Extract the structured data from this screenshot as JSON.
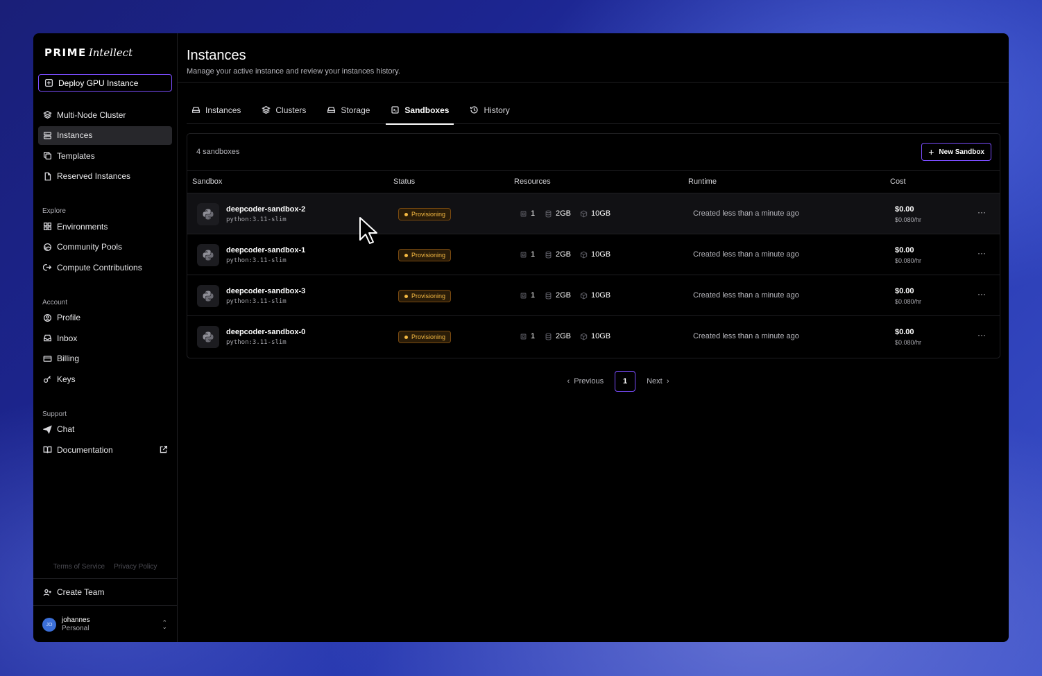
{
  "brand": {
    "name_main": "PRIME",
    "name_italic": "Intellect"
  },
  "sidebar": {
    "deploy_label": "Deploy GPU Instance",
    "primary": [
      {
        "label": "Multi-Node Cluster",
        "icon": "layers-icon"
      },
      {
        "label": "Instances",
        "icon": "server-icon",
        "active": true
      },
      {
        "label": "Templates",
        "icon": "copy-icon"
      },
      {
        "label": "Reserved Instances",
        "icon": "file-icon"
      }
    ],
    "explore_label": "Explore",
    "explore": [
      {
        "label": "Environments",
        "icon": "grid-icon"
      },
      {
        "label": "Community Pools",
        "icon": "pools-icon"
      },
      {
        "label": "Compute Contributions",
        "icon": "contribute-icon"
      }
    ],
    "account_label": "Account",
    "account": [
      {
        "label": "Profile",
        "icon": "user-circle-icon"
      },
      {
        "label": "Inbox",
        "icon": "inbox-icon"
      },
      {
        "label": "Billing",
        "icon": "credit-card-icon"
      },
      {
        "label": "Keys",
        "icon": "key-icon"
      }
    ],
    "support_label": "Support",
    "support": [
      {
        "label": "Chat",
        "icon": "send-icon"
      },
      {
        "label": "Documentation",
        "icon": "book-icon"
      }
    ],
    "terms": "Terms of Service",
    "privacy": "Privacy Policy",
    "create_team": "Create Team",
    "user": {
      "initials": "JO",
      "name": "johannes",
      "plan": "Personal"
    }
  },
  "page": {
    "title": "Instances",
    "subtitle": "Manage your active instance and review your instances history."
  },
  "tabs": [
    {
      "label": "Instances",
      "icon": "hdd-icon"
    },
    {
      "label": "Clusters",
      "icon": "layers-icon"
    },
    {
      "label": "Storage",
      "icon": "hdd-icon"
    },
    {
      "label": "Sandboxes",
      "icon": "sandbox-icon",
      "active": true
    },
    {
      "label": "History",
      "icon": "history-icon"
    }
  ],
  "table": {
    "count_label": "4 sandboxes",
    "new_button": "New Sandbox",
    "columns": {
      "sandbox": "Sandbox",
      "status": "Status",
      "resources": "Resources",
      "runtime": "Runtime",
      "cost": "Cost"
    },
    "rows": [
      {
        "name": "deepcoder-sandbox-2",
        "image": "python:3.11-slim",
        "status": "Provisioning",
        "cpu": "1",
        "mem": "2GB",
        "disk": "10GB",
        "runtime": "Created less than a minute ago",
        "cost": "$0.00",
        "rate": "$0.080/hr"
      },
      {
        "name": "deepcoder-sandbox-1",
        "image": "python:3.11-slim",
        "status": "Provisioning",
        "cpu": "1",
        "mem": "2GB",
        "disk": "10GB",
        "runtime": "Created less than a minute ago",
        "cost": "$0.00",
        "rate": "$0.080/hr"
      },
      {
        "name": "deepcoder-sandbox-3",
        "image": "python:3.11-slim",
        "status": "Provisioning",
        "cpu": "1",
        "mem": "2GB",
        "disk": "10GB",
        "runtime": "Created less than a minute ago",
        "cost": "$0.00",
        "rate": "$0.080/hr"
      },
      {
        "name": "deepcoder-sandbox-0",
        "image": "python:3.11-slim",
        "status": "Provisioning",
        "cpu": "1",
        "mem": "2GB",
        "disk": "10GB",
        "runtime": "Created less than a minute ago",
        "cost": "$0.00",
        "rate": "$0.080/hr"
      }
    ]
  },
  "pagination": {
    "previous": "Previous",
    "current": "1",
    "next": "Next"
  },
  "colors": {
    "accent": "#7b4dff",
    "status_warn": "#f5b942"
  }
}
